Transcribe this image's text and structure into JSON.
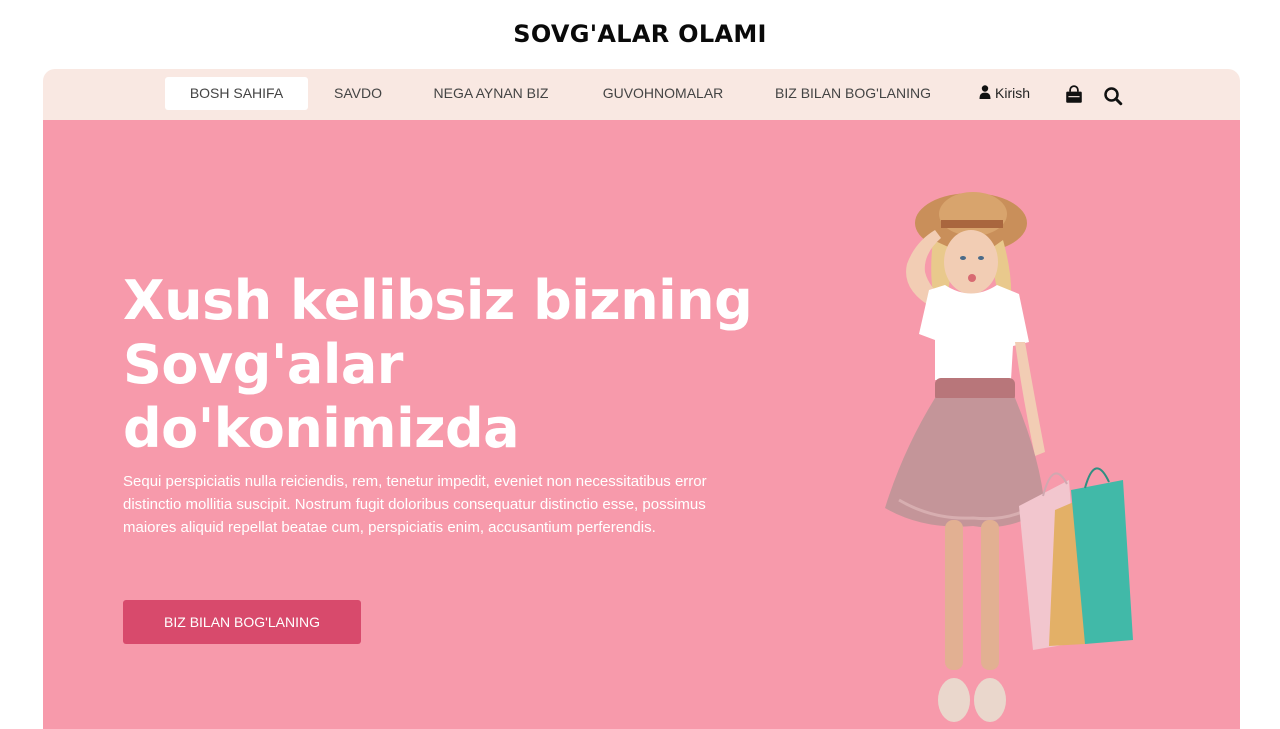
{
  "site": {
    "title": "SOVG'ALAR OLAMI"
  },
  "nav": {
    "items": [
      {
        "label": "BOSH SAHIFA",
        "active": true
      },
      {
        "label": "SAVDO"
      },
      {
        "label": "NEGA AYNAN BIZ"
      },
      {
        "label": "GUVOHNOMALAR"
      },
      {
        "label": "BIZ BILAN BOG'LANING"
      }
    ],
    "login_label": "Kirish",
    "icons": [
      "user-icon",
      "shopping-bag-icon",
      "search-icon"
    ]
  },
  "hero": {
    "heading_line1": "Xush kelibsiz bizning",
    "heading_line2": "Sovg'alar",
    "heading_line3": "do'konimizda",
    "text": "Sequi perspiciatis nulla reiciendis, rem, tenetur impedit, eveniet non necessitatibus error distinctio mollitia suscipit. Nostrum fugit doloribus consequatur distinctio esse, possimus maiores aliquid repellat beatae cum, perspiciatis enim, accusantium perferendis.",
    "button_label": "BIZ BILAN BOG'LANING"
  },
  "colors": {
    "hero_bg": "#f79aab",
    "nav_bg": "#f9e8e2",
    "button_bg": "#d84a6c",
    "title": "#0a0a0a"
  }
}
